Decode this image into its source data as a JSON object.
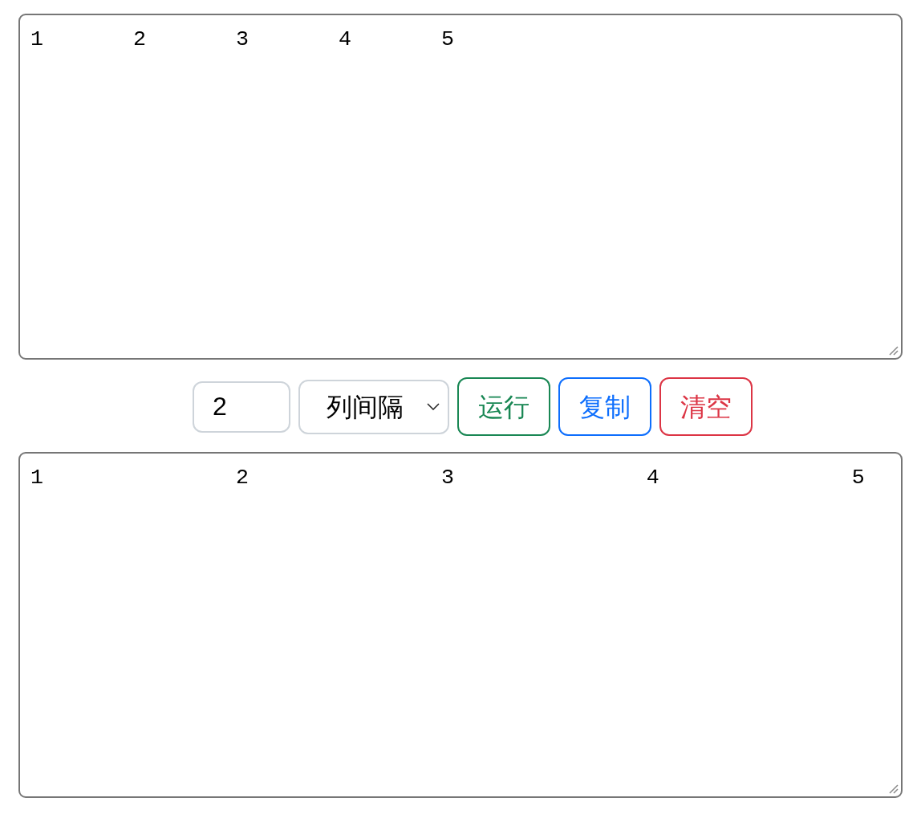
{
  "input_area": {
    "text": "1\t2\t3\t4\t5"
  },
  "controls": {
    "count_field": {
      "value": "2"
    },
    "mode_select": {
      "value": "列间隔"
    },
    "buttons": [
      {
        "label": "运行",
        "kind": "success"
      },
      {
        "label": "复制",
        "kind": "primary"
      },
      {
        "label": "清空",
        "kind": "danger"
      }
    ]
  },
  "output_area": {
    "text": "1\t\t2\t\t3\t\t4\t\t5"
  }
}
